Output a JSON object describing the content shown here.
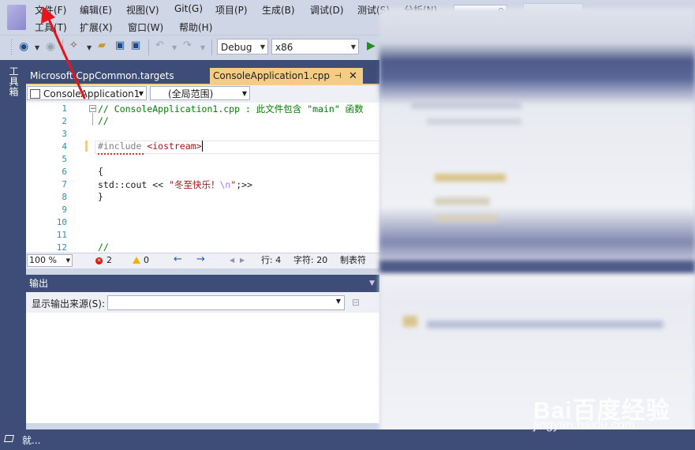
{
  "menu": {
    "row1": [
      "文件(F)",
      "编辑(E)",
      "视图(V)",
      "Git(G)",
      "项目(P)",
      "生成(B)",
      "调试(D)",
      "测试(S)",
      "分析(N)"
    ],
    "row2": [
      "工具(T)",
      "扩展(X)",
      "窗口(W)",
      "帮助(H)"
    ]
  },
  "toolbar": {
    "config": "Debug",
    "platform": "x86"
  },
  "toolbox": {
    "label": "工具箱"
  },
  "tabs": {
    "inactive": "Microsoft.CppCommon.targets",
    "active": "ConsoleApplication1.cpp",
    "pin_icon": "⊣",
    "close_icon": "✕"
  },
  "navbar": {
    "project": "ConsoleApplication1",
    "scope": "(全局范围)"
  },
  "editor": {
    "line_numbers": [
      "1",
      "2",
      "3",
      "4",
      "5",
      "6",
      "7",
      "8",
      "9",
      "10",
      "11",
      "12"
    ],
    "line1": "// ConsoleApplication1.cpp : 此文件包含 \"main\" 函数",
    "line2": "//",
    "line4_directive": "#include",
    "line4_header": " <iostream>",
    "line6": "{",
    "line7_code": "std::cout << ",
    "line7_str": "\"冬至快乐！",
    "line7_esc": "\\n",
    "line7_str_end": "\"",
    "line7_tail": ";>>",
    "line8": "}",
    "line12": "//"
  },
  "editor_status": {
    "zoom": "100 %",
    "errors": "2",
    "warnings": "0",
    "line": "行: 4",
    "column": "字符: 20",
    "tab_mode": "制表符"
  },
  "output": {
    "title": "输出",
    "source_label": "显示输出来源(S):"
  },
  "status": {
    "text": "就..."
  },
  "watermark": {
    "brand": "Bai百度经验",
    "url": "jingyan.baidu.com"
  },
  "colors": {
    "chrome": "#cfd6e5",
    "dark_panel": "#3d4d77",
    "active_tab": "#f5cc84",
    "annotation_arrow": "#e8141c"
  }
}
